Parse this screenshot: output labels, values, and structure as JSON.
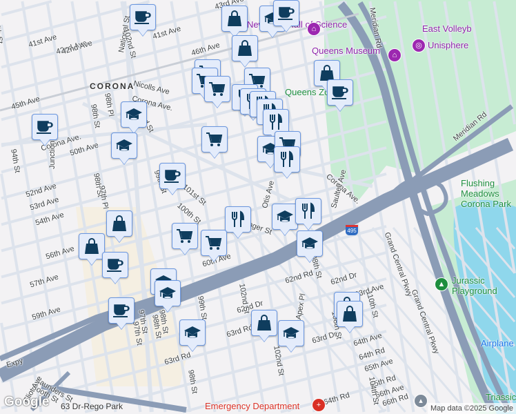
{
  "map": {
    "colors": {
      "land": "#f3f2f4",
      "park": "#c7ecd3",
      "water": "#8fd7ec",
      "highway": "#8b9cb6",
      "street": "#ffffff",
      "marker_fill": "#e4ecfb",
      "marker_border": "#6b97e0",
      "icon": "#0f3d5e"
    }
  },
  "neighborhood": "CORONA",
  "labels": [
    "41st Ave",
    "41st Ave",
    "42nd Ave",
    "45th Ave",
    "Corona Ave.",
    "50th Ave",
    "52nd Ave",
    "53rd Ave",
    "54th Ave",
    "56th Ave",
    "57th Ave",
    "59th Ave",
    "Junction Blvd",
    "National St",
    "102nd St",
    "46th Ave",
    "Nicolls Ave",
    "Corona Ave.",
    "98th St",
    "98th Pl",
    "102nd St",
    "98th St",
    "97th Pl",
    "99th St",
    "101st St",
    "100th St",
    "Otis Ave",
    "Corona Ave.",
    "Saultell Ave",
    "60th Ave",
    "62nd Rd",
    "62nd Dr",
    "108th St",
    "Apex Pl",
    "102nd St",
    "62nd Dr",
    "63rd Ave",
    "63rd Rd",
    "63rd Dr",
    "64th Ave",
    "64th Rd",
    "65th Ave",
    "65th Rd",
    "66th Ave",
    "66th Rd",
    "110th St",
    "Grand Central Pkwy",
    "Grand Central Pkwy",
    "Meridian Rd",
    "Meridian Rd",
    "97th St",
    "98th St",
    "99th St",
    "98th St",
    "Saunders St",
    "Booth St",
    "Eliot Ave",
    "63rd Rd",
    "94th St",
    "Expy",
    "97th St",
    "98th St",
    "95th St",
    "42nd Ave",
    "43rd Ave",
    "108th St",
    "64th Rd",
    "102nd St",
    "104th St",
    "Granger St"
  ],
  "pois": {
    "hall_of_science": "New York Hall of Science",
    "queens_museum": "Queens Museum",
    "unisphere": "Unisphere",
    "queens_zoo": "Queens Zoo",
    "east_volleyball": "East Volleyb",
    "flushing_meadows": "Flushing Meadows Corona Park",
    "jurassic": "Jurassic Playground",
    "emergency": "Emergency Department",
    "rego_park": "63 Dr-Rego Park",
    "triassic": "Triassic",
    "airplane": "Airplane",
    "hwy_shield": "495"
  },
  "markers": [
    "coffee",
    "shopping",
    "shopping",
    "school",
    "coffee",
    "shopping",
    "cart",
    "cart",
    "cart",
    "cart",
    "restaurant",
    "restaurant",
    "restaurant",
    "restaurant",
    "restaurant",
    "coffee",
    "coffee",
    "school",
    "school",
    "cart",
    "school",
    "cart",
    "restaurant",
    "coffee",
    "restaurant",
    "school",
    "restaurant",
    "school",
    "shopping",
    "shopping",
    "coffee",
    "cart",
    "cart",
    "school",
    "school",
    "school",
    "coffee",
    "shopping",
    "shopping",
    "shopping",
    "school"
  ],
  "attribution": "Map data ©2025 Google",
  "logo": "Google"
}
